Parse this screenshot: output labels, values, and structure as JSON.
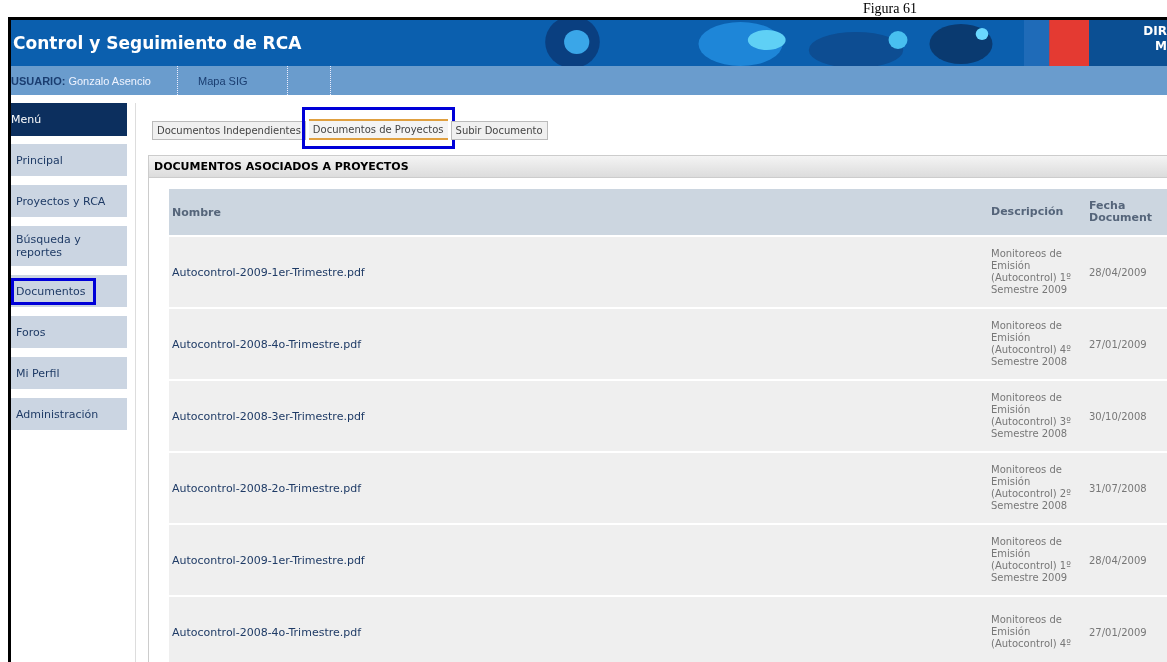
{
  "caption": "Figura 61",
  "header": {
    "title": "Control y Seguimiento de RCA",
    "logo_text": [
      "DIR",
      "M"
    ]
  },
  "nav": {
    "user_label": "USUARIO:",
    "user_name": "Gonzalo Asencio",
    "links": [
      "Mapa SIG"
    ]
  },
  "sidebar": {
    "title": "Menú",
    "items": [
      {
        "label": "Principal",
        "selected": false
      },
      {
        "label": "Proyectos y RCA",
        "selected": false
      },
      {
        "label": "Búsqueda y reportes",
        "selected": false
      },
      {
        "label": "Documentos",
        "selected": true
      },
      {
        "label": "Foros",
        "selected": false
      },
      {
        "label": "Mi Perfil",
        "selected": false
      },
      {
        "label": "Administración",
        "selected": false
      }
    ]
  },
  "tabs": [
    {
      "label": "Documentos Independientes",
      "selected": false
    },
    {
      "label": "Documentos de Proyectos",
      "selected": true
    },
    {
      "label": "Subir Documento",
      "selected": false
    }
  ],
  "panel": {
    "title": "DOCUMENTOS ASOCIADOS A PROYECTOS",
    "table": {
      "columns": [
        "Nombre",
        "Descripción",
        "Fecha Document"
      ],
      "rows": [
        {
          "name": "Autocontrol-2009-1er-Trimestre.pdf",
          "description": "Monitoreos de Emisión (Autocontrol) 1º Semestre 2009",
          "date": "28/04/2009"
        },
        {
          "name": "Autocontrol-2008-4o-Trimestre.pdf",
          "description": "Monitoreos de Emisión (Autocontrol) 4º Semestre 2008",
          "date": "27/01/2009"
        },
        {
          "name": "Autocontrol-2008-3er-Trimestre.pdf",
          "description": "Monitoreos de Emisión (Autocontrol) 3º Semestre 2008",
          "date": "30/10/2008"
        },
        {
          "name": "Autocontrol-2008-2o-Trimestre.pdf",
          "description": "Monitoreos de Emisión (Autocontrol) 2º Semestre 2008",
          "date": "31/07/2008"
        },
        {
          "name": "Autocontrol-2009-1er-Trimestre.pdf",
          "description": "Monitoreos de Emisión (Autocontrol) 1º Semestre 2009",
          "date": "28/04/2009"
        },
        {
          "name": "Autocontrol-2008-4o-Trimestre.pdf",
          "description": "Monitoreos de Emisión (Autocontrol) 4º",
          "date": "27/01/2009"
        }
      ]
    }
  }
}
